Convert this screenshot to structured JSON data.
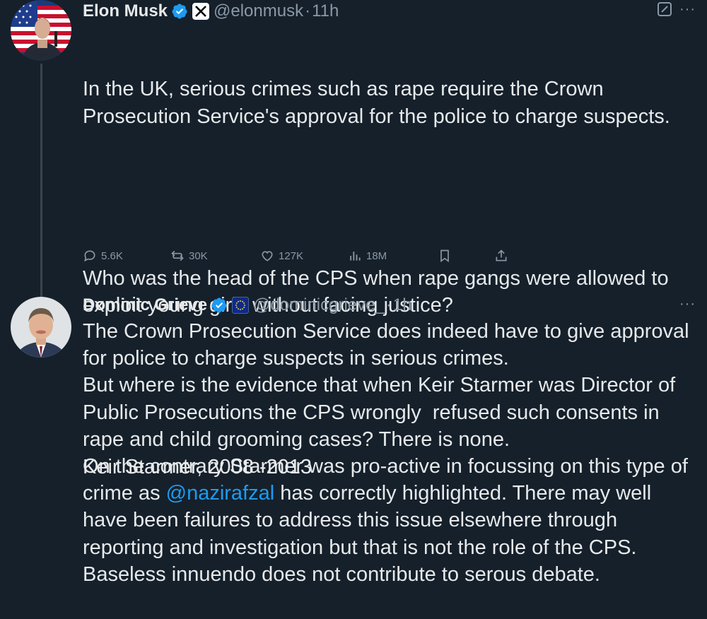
{
  "tweets": [
    {
      "author": {
        "display_name": "Elon Musk",
        "handle": "@elonmusk",
        "verified": true,
        "affiliation_badge": "x-logo",
        "avatar": "elon-musk-avatar"
      },
      "time_separator": "·",
      "time": "11h",
      "top_icons": [
        "grok-icon",
        "more-icon"
      ],
      "more_label": "···",
      "paragraphs": [
        "In the UK, serious crimes such as rape require the Crown Prosecution Service's approval for the police to charge suspects.",
        "Who was the head of the CPS when rape gangs were allowed to exploit young girls without facing justice?",
        "Keir Starmer, 2008 -2013"
      ],
      "actions": {
        "replies": "5.6K",
        "reposts": "30K",
        "likes": "127K",
        "views": "18M"
      }
    },
    {
      "author": {
        "display_name": "Dominic Grieve",
        "handle": "@dominicgrieve_",
        "verified": true,
        "affiliation_badge": "eu-flag",
        "avatar": "dominic-grieve-avatar"
      },
      "time_separator": "·",
      "time": "1h",
      "more_label": "···",
      "text_before_mention": "The Crown Prosecution Service does indeed have to give approval for police to charge suspects in serious crimes.\nBut where is the evidence that when Keir Starmer was Director of Public Prosecutions the CPS wrongly  refused such consents in rape and child grooming cases? There is none.\nOn the contrary Starmer was pro-active in focussing on this type of crime as ",
      "mention": "@nazirafzal",
      "text_after_mention": " has correctly highlighted. There may well have been failures to address this issue elsewhere through reporting and investigation but that is not the role of the CPS.\nBaseless innuendo does not contribute to serous debate."
    }
  ],
  "colors": {
    "background": "#15202b",
    "text": "#e7e9ea",
    "secondary": "#8b98a5",
    "accent": "#1d9bf0"
  }
}
